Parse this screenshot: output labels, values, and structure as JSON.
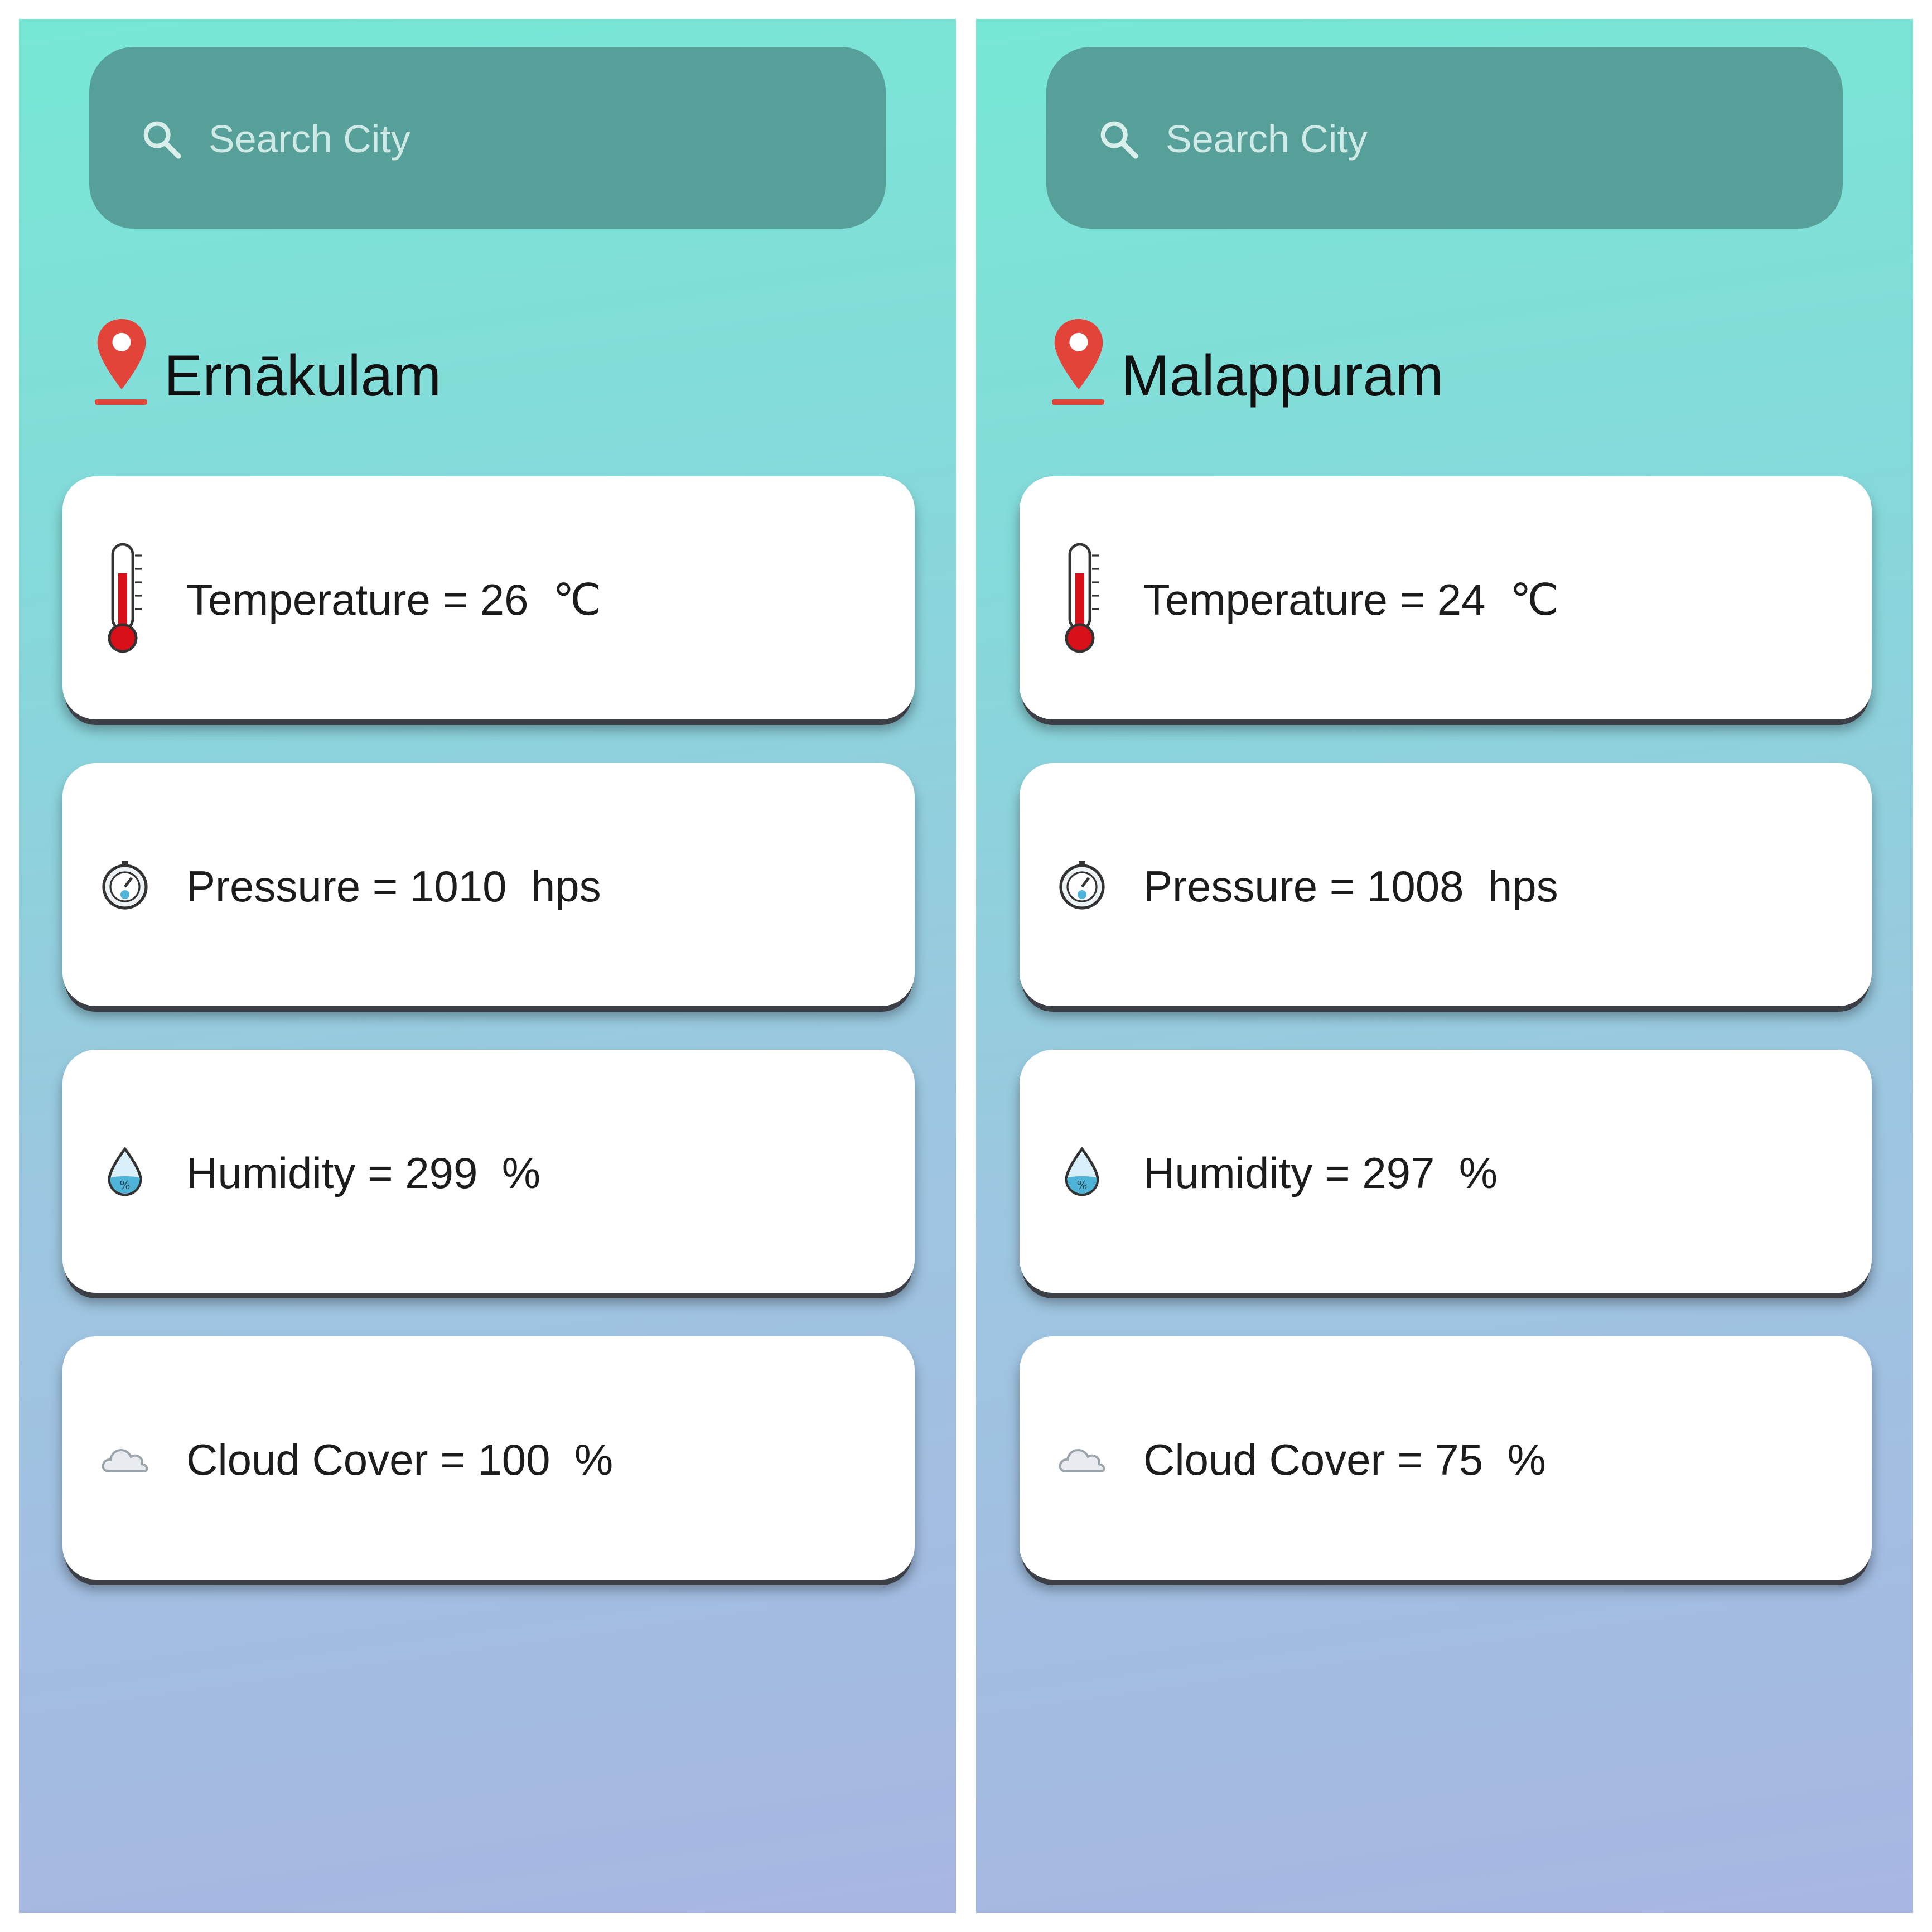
{
  "screens": [
    {
      "search": {
        "placeholder": "Search City",
        "icon": "search-icon"
      },
      "city": "Ernākulam",
      "cards": [
        {
          "icon": "thermometer-icon",
          "label": "Temperature = 26  ℃"
        },
        {
          "icon": "barometer-icon",
          "label": "Pressure = 1010  hps"
        },
        {
          "icon": "humidity-drop-icon",
          "label": "Humidity = 299  %"
        },
        {
          "icon": "cloud-icon",
          "label": "Cloud Cover = 100  %"
        }
      ]
    },
    {
      "search": {
        "placeholder": "Search City",
        "icon": "search-icon"
      },
      "city": "Malappuram",
      "cards": [
        {
          "icon": "thermometer-icon",
          "label": "Temperature = 24  ℃"
        },
        {
          "icon": "barometer-icon",
          "label": "Pressure = 1008  hps"
        },
        {
          "icon": "humidity-drop-icon",
          "label": "Humidity = 297  %"
        },
        {
          "icon": "cloud-icon",
          "label": "Cloud Cover = 75  %"
        }
      ]
    }
  ],
  "colors": {
    "gradient_top": "#78e8d6",
    "gradient_bottom": "#a8b6e3",
    "search_bg": "#57a09a",
    "pin": "#e2443a",
    "card_bg": "#ffffff"
  }
}
